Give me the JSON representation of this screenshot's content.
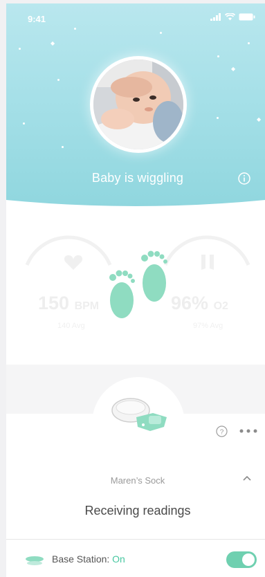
{
  "status_bar": {
    "time": "9:41"
  },
  "header": {
    "status_title": "Baby is wiggling"
  },
  "gauges": {
    "heart": {
      "value": "150",
      "unit": "BPM",
      "sub": "140 Avg"
    },
    "oxygen": {
      "value": "96%",
      "unit": "O2",
      "sub": "97% Avg"
    }
  },
  "device": {
    "name": "Maren’s Sock",
    "reading_status": "Receiving readings"
  },
  "base_station": {
    "label": "Base Station: ",
    "value": "On",
    "toggle_on": true
  },
  "colors": {
    "header_teal": "#a6e0e8",
    "accent_green": "#47c7a0",
    "footprints": "#8fdcc1",
    "toggle": "#6fd0b0"
  },
  "icons": [
    "signal-icon",
    "wifi-icon",
    "battery-icon",
    "info-icon",
    "footprints-icon",
    "help-icon",
    "more-icon",
    "chevron-up-icon",
    "base-station-icon",
    "sock-device-icon"
  ]
}
